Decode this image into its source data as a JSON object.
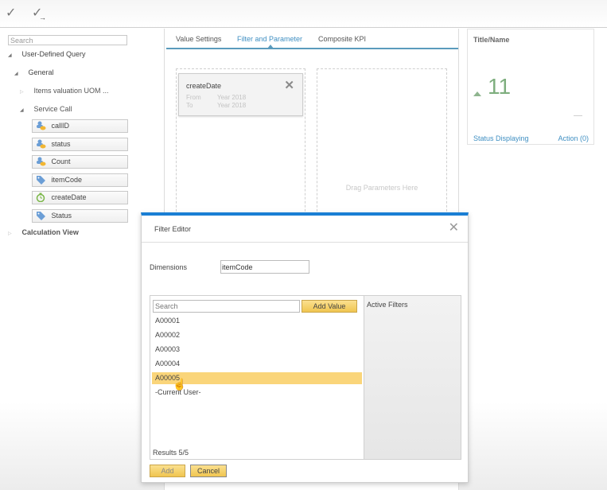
{
  "toolbar": {
    "icons": [
      {
        "name": "checkmark-icon",
        "glyph": "✓"
      },
      {
        "name": "checkmark-arrow-icon",
        "glyph": "✓",
        "arrow": "→"
      }
    ]
  },
  "sidebar": {
    "search_placeholder": "Search",
    "tree": {
      "root": "User-Defined Query",
      "general": "General",
      "items_valuation": "Items valuation UOM ...",
      "service_call": "Service Call",
      "calc_view": "Calculation View",
      "expanded_glyph": "◢",
      "collapsed_glyph": "▷"
    },
    "fields": [
      {
        "label": "callID",
        "icon": "measure-icon"
      },
      {
        "label": "status",
        "icon": "measure-icon"
      },
      {
        "label": "Count",
        "icon": "measure-icon"
      },
      {
        "label": "itemCode",
        "icon": "tag-icon"
      },
      {
        "label": "createDate",
        "icon": "clock-icon"
      },
      {
        "label": "Status",
        "icon": "tag-icon"
      }
    ]
  },
  "center": {
    "tabs": [
      {
        "label": "Value Settings",
        "active": false
      },
      {
        "label": "Filter and Parameter",
        "active": true
      },
      {
        "label": "Composite KPI",
        "active": false
      }
    ],
    "filter_card": {
      "title": "createDate",
      "close_glyph": "✕",
      "from_label": "From",
      "from_value": "Year 2018",
      "to_label": "To",
      "to_value": "Year 2018"
    },
    "drag_hint": "Drag Parameters Here"
  },
  "kpi": {
    "title": "Title/Name",
    "value": "11",
    "trend": "up",
    "status_link": "Status Displaying",
    "action_link": "Action (0)",
    "colors": {
      "value": "#7eae7e",
      "link": "#3f8fc2"
    }
  },
  "modal": {
    "title": "Filter Editor",
    "close_glyph": "✕",
    "dimensions_label": "Dimensions",
    "dimensions_value": "itemCode",
    "search_placeholder": "Search",
    "add_value_label": "Add Value",
    "values": [
      {
        "label": "A00001",
        "selected": false
      },
      {
        "label": "A00002",
        "selected": false
      },
      {
        "label": "A00003",
        "selected": false
      },
      {
        "label": "A00004",
        "selected": false
      },
      {
        "label": "A00005",
        "selected": true
      },
      {
        "label": "-Current User-",
        "selected": false
      }
    ],
    "results_text": "Results 5/5",
    "active_filters_label": "Active Filters",
    "add_label": "Add",
    "cancel_label": "Cancel",
    "accent_color": "#1a7fd4",
    "highlight_color": "#fad57a"
  }
}
